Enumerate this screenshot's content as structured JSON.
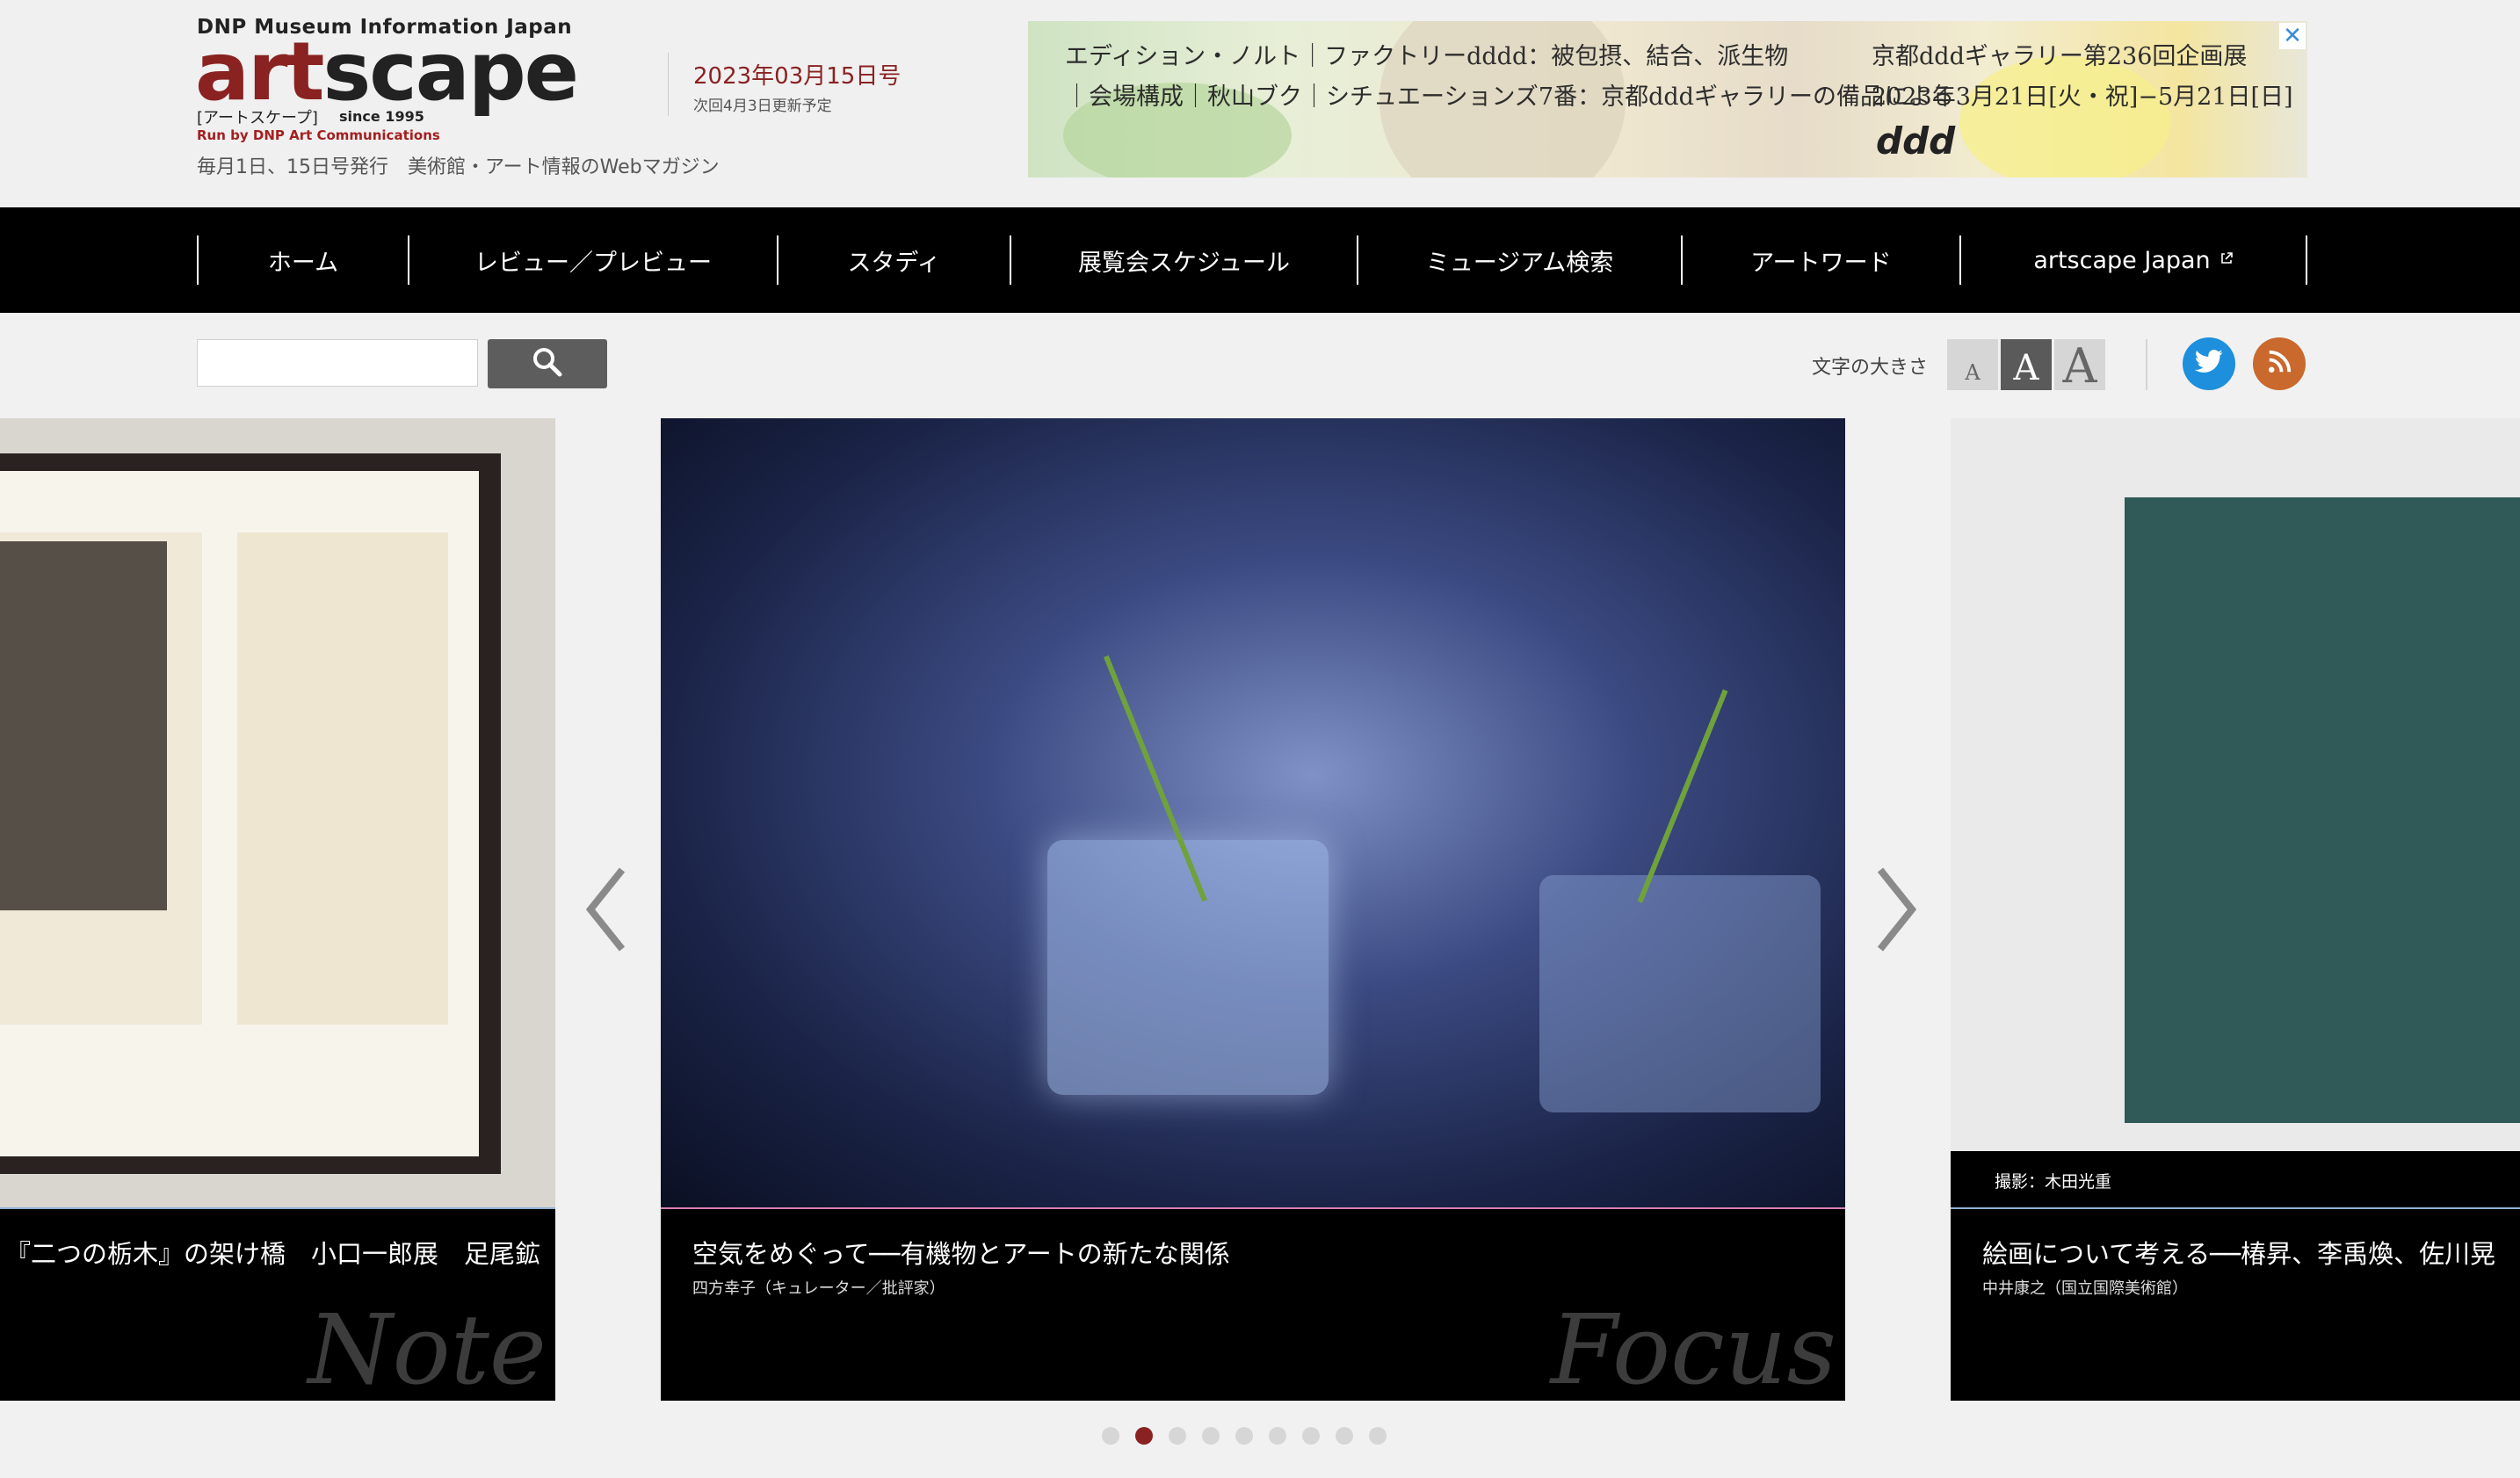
{
  "header": {
    "brand_top": "DNP Museum Information Japan",
    "logo_art": "art",
    "logo_scape": "scape",
    "reading": "[アートスケープ]",
    "since": "since 1995",
    "run_by": "Run by DNP Art Communications",
    "tagline": "毎月1日、15日号発行　美術館・アート情報のWebマガジン",
    "issue_date": "2023年03月15日号",
    "next_update": "次回4月3日更新予定"
  },
  "ad": {
    "line1": "エディション・ノルト｜ファクトリーdddd：被包摂、結合、派生物",
    "line2": "｜会場構成｜秋山ブク｜シチュエーションズ7番：京都dddギャラリーの備品による",
    "right1": "京都dddギャラリー第236回企画展",
    "right2": "2023年3月21日[火・祝]−5月21日[日]",
    "logo": "ddd",
    "close_label": "✕"
  },
  "nav": {
    "items": [
      {
        "label": "ホーム"
      },
      {
        "label": "レビュー／プレビュー"
      },
      {
        "label": "スタディ"
      },
      {
        "label": "展覧会スケジュール"
      },
      {
        "label": "ミュージアム検索"
      },
      {
        "label": "アートワード"
      },
      {
        "label": "artscape Japan"
      }
    ]
  },
  "toolbar": {
    "search_value": "",
    "text_size_label": "文字の大きさ",
    "text_size_buttons": [
      "A",
      "A",
      "A"
    ]
  },
  "carousel": {
    "slides": [
      {
        "title": "『二つの栃木』の架け橋　小口一郎展　足尾鉱",
        "author": "",
        "category": "Note",
        "line_color": "#8fb2d6"
      },
      {
        "title": "空気をめぐって──有機物とアートの新たな関係",
        "author": "四方幸子（キュレーター／批評家）",
        "category": "Focus",
        "line_color": "#d97fb2"
      },
      {
        "title": "絵画について考える──椿昇、李禹煥、佐川晃",
        "author": "中井康之（国立国際美術館）",
        "category": "",
        "photo_credit": "撮影：木田光重",
        "line_color": "#8fb2d6"
      }
    ],
    "dots_total": 9,
    "active_dot": 2
  },
  "colors": {
    "brand_red": "#8a2222",
    "nav_bg": "#000000",
    "twitter": "#1d8fdc",
    "rss": "#c9692e"
  },
  "icons": [
    "search-icon",
    "twitter-icon",
    "rss-icon",
    "external-link-icon",
    "chevron-left-icon",
    "chevron-right-icon",
    "close-icon"
  ]
}
